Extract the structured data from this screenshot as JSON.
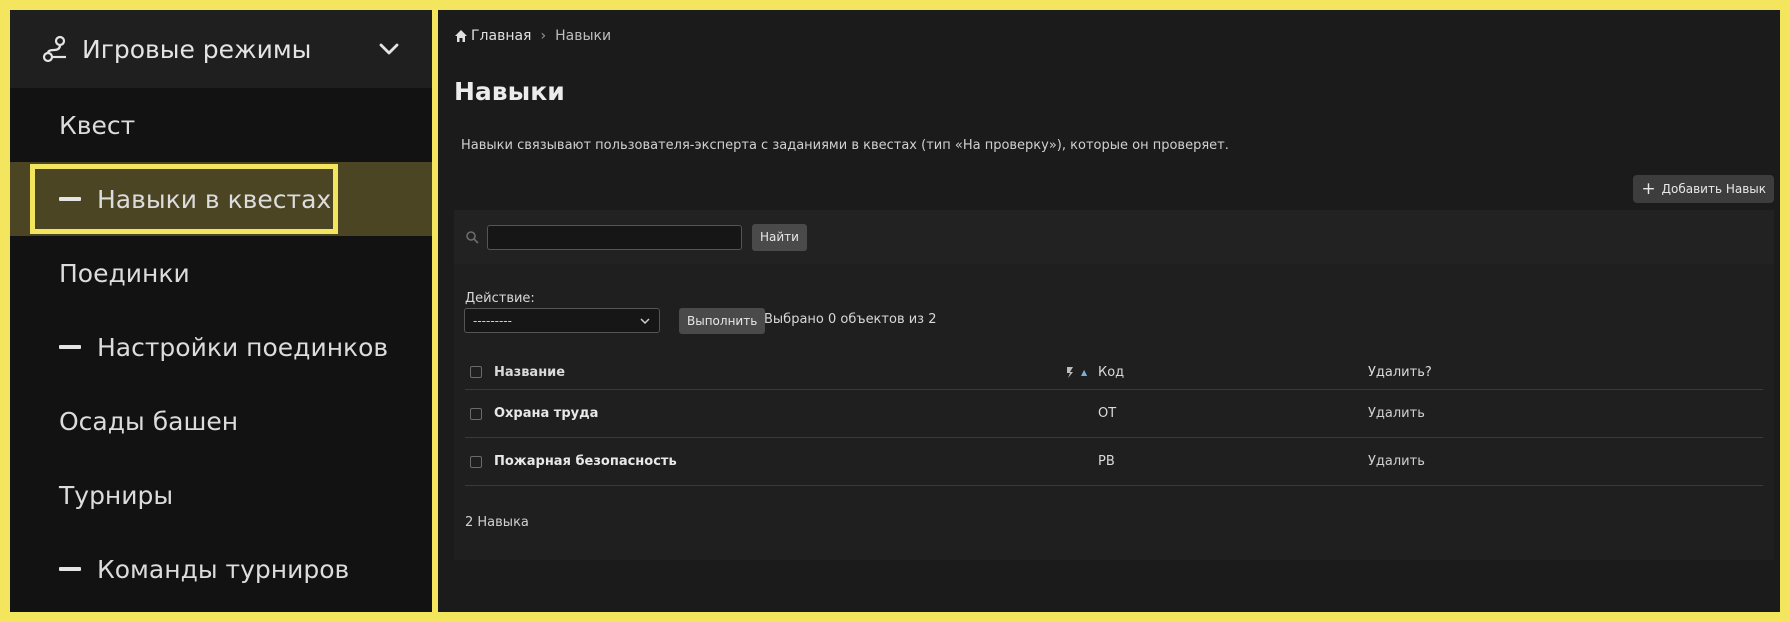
{
  "sidebar": {
    "group_title": "Игровые режимы",
    "items": [
      {
        "label": "Квест",
        "sub": false,
        "active": false
      },
      {
        "label": "Навыки в квестах",
        "sub": true,
        "active": true
      },
      {
        "label": "Поединки",
        "sub": false,
        "active": false
      },
      {
        "label": "Настройки поединков",
        "sub": true,
        "active": false
      },
      {
        "label": "Осады башен",
        "sub": false,
        "active": false
      },
      {
        "label": "Турниры",
        "sub": false,
        "active": false
      },
      {
        "label": "Команды турниров",
        "sub": true,
        "active": false
      }
    ]
  },
  "breadcrumb": {
    "home": "Главная",
    "separator": "›",
    "current": "Навыки"
  },
  "page": {
    "title": "Навыки",
    "description": "Навыки связывают пользователя-эксперта с заданиями в квестах (тип «На проверку»), которые он проверяет.",
    "add_button": "Добавить Навык"
  },
  "search": {
    "value": "",
    "button": "Найти"
  },
  "actions": {
    "label": "Действие:",
    "selected": "---------",
    "run_button": "Выполнить",
    "selected_count": "Выбрано 0 объектов из 2"
  },
  "table": {
    "headers": {
      "name": "Название",
      "code": "Код",
      "delete": "Удалить?"
    },
    "rows": [
      {
        "name": "Охрана труда",
        "code": "OT",
        "delete": "Удалить"
      },
      {
        "name": "Пожарная безопасность",
        "code": "PB",
        "delete": "Удалить"
      }
    ]
  },
  "total": "2 Навыка",
  "colors": {
    "frame": "#f4e55e",
    "active_bg": "#4c4524",
    "sidebar_bg": "#121212",
    "main_bg": "#1b1b1b"
  }
}
